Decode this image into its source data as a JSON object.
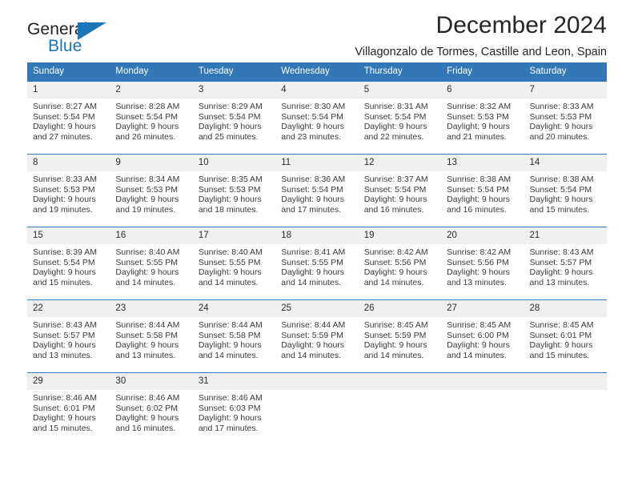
{
  "logo": {
    "word_one": "General",
    "word_two": "Blue",
    "triangle": "blue-triangle",
    "brand_color": "#1b75bb"
  },
  "header": {
    "title": "December 2024",
    "subtitle": "Villagonzalo de Tormes, Castille and Leon, Spain"
  },
  "calendar": {
    "header_bg": "#3277b8",
    "daynum_bg": "#f0f0f0",
    "weekday_headers": [
      "Sunday",
      "Monday",
      "Tuesday",
      "Wednesday",
      "Thursday",
      "Friday",
      "Saturday"
    ],
    "weeks": [
      [
        {
          "day": "1",
          "sunrise": "Sunrise: 8:27 AM",
          "sunset": "Sunset: 5:54 PM",
          "daylight_line1": "Daylight: 9 hours",
          "daylight_line2": "and 27 minutes."
        },
        {
          "day": "2",
          "sunrise": "Sunrise: 8:28 AM",
          "sunset": "Sunset: 5:54 PM",
          "daylight_line1": "Daylight: 9 hours",
          "daylight_line2": "and 26 minutes."
        },
        {
          "day": "3",
          "sunrise": "Sunrise: 8:29 AM",
          "sunset": "Sunset: 5:54 PM",
          "daylight_line1": "Daylight: 9 hours",
          "daylight_line2": "and 25 minutes."
        },
        {
          "day": "4",
          "sunrise": "Sunrise: 8:30 AM",
          "sunset": "Sunset: 5:54 PM",
          "daylight_line1": "Daylight: 9 hours",
          "daylight_line2": "and 23 minutes."
        },
        {
          "day": "5",
          "sunrise": "Sunrise: 8:31 AM",
          "sunset": "Sunset: 5:54 PM",
          "daylight_line1": "Daylight: 9 hours",
          "daylight_line2": "and 22 minutes."
        },
        {
          "day": "6",
          "sunrise": "Sunrise: 8:32 AM",
          "sunset": "Sunset: 5:53 PM",
          "daylight_line1": "Daylight: 9 hours",
          "daylight_line2": "and 21 minutes."
        },
        {
          "day": "7",
          "sunrise": "Sunrise: 8:33 AM",
          "sunset": "Sunset: 5:53 PM",
          "daylight_line1": "Daylight: 9 hours",
          "daylight_line2": "and 20 minutes."
        }
      ],
      [
        {
          "day": "8",
          "sunrise": "Sunrise: 8:33 AM",
          "sunset": "Sunset: 5:53 PM",
          "daylight_line1": "Daylight: 9 hours",
          "daylight_line2": "and 19 minutes."
        },
        {
          "day": "9",
          "sunrise": "Sunrise: 8:34 AM",
          "sunset": "Sunset: 5:53 PM",
          "daylight_line1": "Daylight: 9 hours",
          "daylight_line2": "and 19 minutes."
        },
        {
          "day": "10",
          "sunrise": "Sunrise: 8:35 AM",
          "sunset": "Sunset: 5:53 PM",
          "daylight_line1": "Daylight: 9 hours",
          "daylight_line2": "and 18 minutes."
        },
        {
          "day": "11",
          "sunrise": "Sunrise: 8:36 AM",
          "sunset": "Sunset: 5:54 PM",
          "daylight_line1": "Daylight: 9 hours",
          "daylight_line2": "and 17 minutes."
        },
        {
          "day": "12",
          "sunrise": "Sunrise: 8:37 AM",
          "sunset": "Sunset: 5:54 PM",
          "daylight_line1": "Daylight: 9 hours",
          "daylight_line2": "and 16 minutes."
        },
        {
          "day": "13",
          "sunrise": "Sunrise: 8:38 AM",
          "sunset": "Sunset: 5:54 PM",
          "daylight_line1": "Daylight: 9 hours",
          "daylight_line2": "and 16 minutes."
        },
        {
          "day": "14",
          "sunrise": "Sunrise: 8:38 AM",
          "sunset": "Sunset: 5:54 PM",
          "daylight_line1": "Daylight: 9 hours",
          "daylight_line2": "and 15 minutes."
        }
      ],
      [
        {
          "day": "15",
          "sunrise": "Sunrise: 8:39 AM",
          "sunset": "Sunset: 5:54 PM",
          "daylight_line1": "Daylight: 9 hours",
          "daylight_line2": "and 15 minutes."
        },
        {
          "day": "16",
          "sunrise": "Sunrise: 8:40 AM",
          "sunset": "Sunset: 5:55 PM",
          "daylight_line1": "Daylight: 9 hours",
          "daylight_line2": "and 14 minutes."
        },
        {
          "day": "17",
          "sunrise": "Sunrise: 8:40 AM",
          "sunset": "Sunset: 5:55 PM",
          "daylight_line1": "Daylight: 9 hours",
          "daylight_line2": "and 14 minutes."
        },
        {
          "day": "18",
          "sunrise": "Sunrise: 8:41 AM",
          "sunset": "Sunset: 5:55 PM",
          "daylight_line1": "Daylight: 9 hours",
          "daylight_line2": "and 14 minutes."
        },
        {
          "day": "19",
          "sunrise": "Sunrise: 8:42 AM",
          "sunset": "Sunset: 5:56 PM",
          "daylight_line1": "Daylight: 9 hours",
          "daylight_line2": "and 14 minutes."
        },
        {
          "day": "20",
          "sunrise": "Sunrise: 8:42 AM",
          "sunset": "Sunset: 5:56 PM",
          "daylight_line1": "Daylight: 9 hours",
          "daylight_line2": "and 13 minutes."
        },
        {
          "day": "21",
          "sunrise": "Sunrise: 8:43 AM",
          "sunset": "Sunset: 5:57 PM",
          "daylight_line1": "Daylight: 9 hours",
          "daylight_line2": "and 13 minutes."
        }
      ],
      [
        {
          "day": "22",
          "sunrise": "Sunrise: 8:43 AM",
          "sunset": "Sunset: 5:57 PM",
          "daylight_line1": "Daylight: 9 hours",
          "daylight_line2": "and 13 minutes."
        },
        {
          "day": "23",
          "sunrise": "Sunrise: 8:44 AM",
          "sunset": "Sunset: 5:58 PM",
          "daylight_line1": "Daylight: 9 hours",
          "daylight_line2": "and 13 minutes."
        },
        {
          "day": "24",
          "sunrise": "Sunrise: 8:44 AM",
          "sunset": "Sunset: 5:58 PM",
          "daylight_line1": "Daylight: 9 hours",
          "daylight_line2": "and 14 minutes."
        },
        {
          "day": "25",
          "sunrise": "Sunrise: 8:44 AM",
          "sunset": "Sunset: 5:59 PM",
          "daylight_line1": "Daylight: 9 hours",
          "daylight_line2": "and 14 minutes."
        },
        {
          "day": "26",
          "sunrise": "Sunrise: 8:45 AM",
          "sunset": "Sunset: 5:59 PM",
          "daylight_line1": "Daylight: 9 hours",
          "daylight_line2": "and 14 minutes."
        },
        {
          "day": "27",
          "sunrise": "Sunrise: 8:45 AM",
          "sunset": "Sunset: 6:00 PM",
          "daylight_line1": "Daylight: 9 hours",
          "daylight_line2": "and 14 minutes."
        },
        {
          "day": "28",
          "sunrise": "Sunrise: 8:45 AM",
          "sunset": "Sunset: 6:01 PM",
          "daylight_line1": "Daylight: 9 hours",
          "daylight_line2": "and 15 minutes."
        }
      ],
      [
        {
          "day": "29",
          "sunrise": "Sunrise: 8:46 AM",
          "sunset": "Sunset: 6:01 PM",
          "daylight_line1": "Daylight: 9 hours",
          "daylight_line2": "and 15 minutes."
        },
        {
          "day": "30",
          "sunrise": "Sunrise: 8:46 AM",
          "sunset": "Sunset: 6:02 PM",
          "daylight_line1": "Daylight: 9 hours",
          "daylight_line2": "and 16 minutes."
        },
        {
          "day": "31",
          "sunrise": "Sunrise: 8:46 AM",
          "sunset": "Sunset: 6:03 PM",
          "daylight_line1": "Daylight: 9 hours",
          "daylight_line2": "and 17 minutes."
        },
        {
          "day": "",
          "sunrise": "",
          "sunset": "",
          "daylight_line1": "",
          "daylight_line2": ""
        },
        {
          "day": "",
          "sunrise": "",
          "sunset": "",
          "daylight_line1": "",
          "daylight_line2": ""
        },
        {
          "day": "",
          "sunrise": "",
          "sunset": "",
          "daylight_line1": "",
          "daylight_line2": ""
        },
        {
          "day": "",
          "sunrise": "",
          "sunset": "",
          "daylight_line1": "",
          "daylight_line2": ""
        }
      ]
    ]
  }
}
